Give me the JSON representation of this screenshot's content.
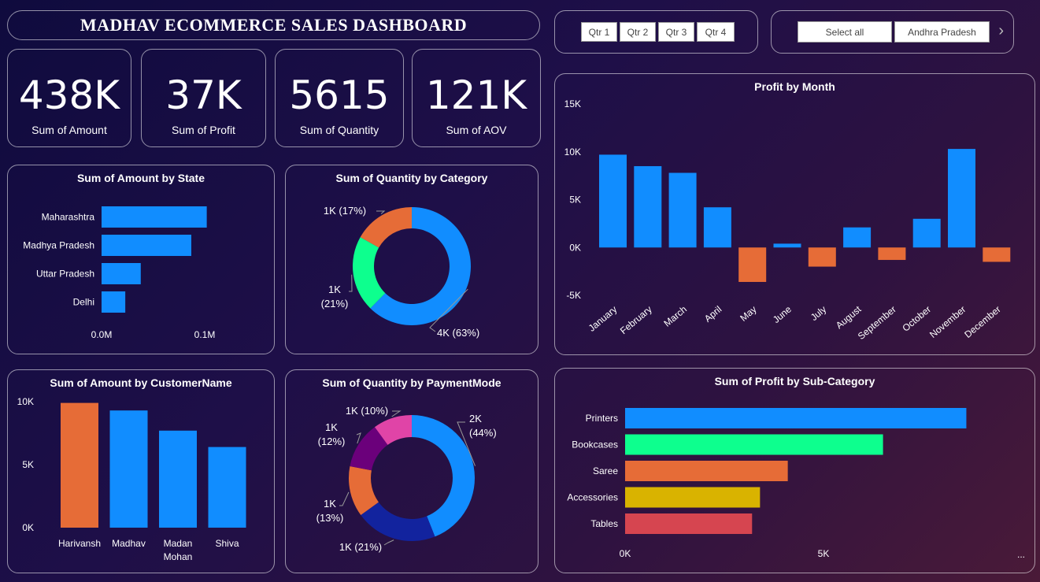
{
  "title": "MADHAV ECOMMERCE SALES DASHBOARD",
  "quarters": [
    "Qtr 1",
    "Qtr 2",
    "Qtr 3",
    "Qtr 4"
  ],
  "states_slicer": [
    "Select all",
    "Andhra Pradesh"
  ],
  "kpis": [
    {
      "value": "438K",
      "label": "Sum of Amount"
    },
    {
      "value": "37K",
      "label": "Sum of Profit"
    },
    {
      "value": "5615",
      "label": "Sum of Quantity"
    },
    {
      "value": "121K",
      "label": "Sum of AOV"
    }
  ],
  "colors": {
    "blue": "#118dff",
    "orange": "#e66c37",
    "green": "#0dff8e",
    "purple": "#6b007b",
    "pink": "#e044a7",
    "navy": "#12239e",
    "yellow": "#d9b300",
    "red": "#d64550"
  },
  "chart_data": [
    {
      "id": "amount_by_state",
      "type": "bar",
      "orientation": "horizontal",
      "title": "Sum of Amount by State",
      "categories": [
        "Maharashtra",
        "Madhya Pradesh",
        "Uttar Pradesh",
        "Delhi"
      ],
      "values": [
        0.102,
        0.087,
        0.038,
        0.023
      ],
      "xticks": [
        "0.0M",
        "0.1M"
      ],
      "xlim": [
        0,
        0.1
      ]
    },
    {
      "id": "quantity_by_category",
      "type": "pie",
      "donut": true,
      "title": "Sum of Quantity by Category",
      "slices": [
        {
          "value": 63,
          "label": "4K (63%)",
          "color": "#118dff"
        },
        {
          "value": 21,
          "label_lines": [
            "1K",
            "(21%)"
          ],
          "color": "#0dff8e"
        },
        {
          "value": 17,
          "label": "1K (17%)",
          "color": "#e66c37"
        }
      ]
    },
    {
      "id": "profit_by_month",
      "type": "bar",
      "title": "Profit by Month",
      "categories": [
        "January",
        "February",
        "March",
        "April",
        "May",
        "June",
        "July",
        "August",
        "September",
        "October",
        "November",
        "December"
      ],
      "values": [
        9700,
        8500,
        7800,
        4200,
        -3600,
        400,
        -2000,
        2100,
        -1300,
        3000,
        10300,
        -1500
      ],
      "yticks": [
        "15K",
        "10K",
        "5K",
        "0K",
        "-5K"
      ],
      "ylim": [
        -5000,
        15000
      ]
    },
    {
      "id": "amount_by_customer",
      "type": "bar",
      "title": "Sum of Amount by CustomerName",
      "categories": [
        [
          "Harivansh"
        ],
        [
          "Madhav"
        ],
        [
          "Madan",
          "Mohan"
        ],
        [
          "Shiva"
        ]
      ],
      "values": [
        9900,
        9300,
        7700,
        6400
      ],
      "colors": [
        "#e66c37",
        "#118dff",
        "#118dff",
        "#118dff"
      ],
      "yticks": [
        "10K",
        "5K",
        "0K"
      ],
      "ylim": [
        0,
        10000
      ]
    },
    {
      "id": "quantity_by_paymentmode",
      "type": "pie",
      "donut": true,
      "title": "Sum of Quantity by PaymentMode",
      "slices": [
        {
          "value": 44,
          "label_lines": [
            "2K",
            "(44%)"
          ],
          "color": "#118dff"
        },
        {
          "value": 21,
          "label": "1K (21%)",
          "color": "#12239e"
        },
        {
          "value": 13,
          "label_lines": [
            "1K",
            "(13%)"
          ],
          "color": "#e66c37"
        },
        {
          "value": 12,
          "label_lines": [
            "1K",
            "(12%)"
          ],
          "color": "#6b007b"
        },
        {
          "value": 10,
          "label": "1K (10%)",
          "color": "#e044a7"
        }
      ]
    },
    {
      "id": "profit_by_subcategory",
      "type": "bar",
      "orientation": "horizontal",
      "title": "Sum of Profit by Sub-Category",
      "categories": [
        "Printers",
        "Bookcases",
        "Saree",
        "Accessories",
        "Tables"
      ],
      "values": [
        8600,
        6500,
        4100,
        3400,
        3200
      ],
      "colors": [
        "#118dff",
        "#0dff8e",
        "#e66c37",
        "#d9b300",
        "#d64550"
      ],
      "xticks": [
        "0K",
        "5K"
      ],
      "xlim": [
        0,
        5000
      ]
    }
  ]
}
